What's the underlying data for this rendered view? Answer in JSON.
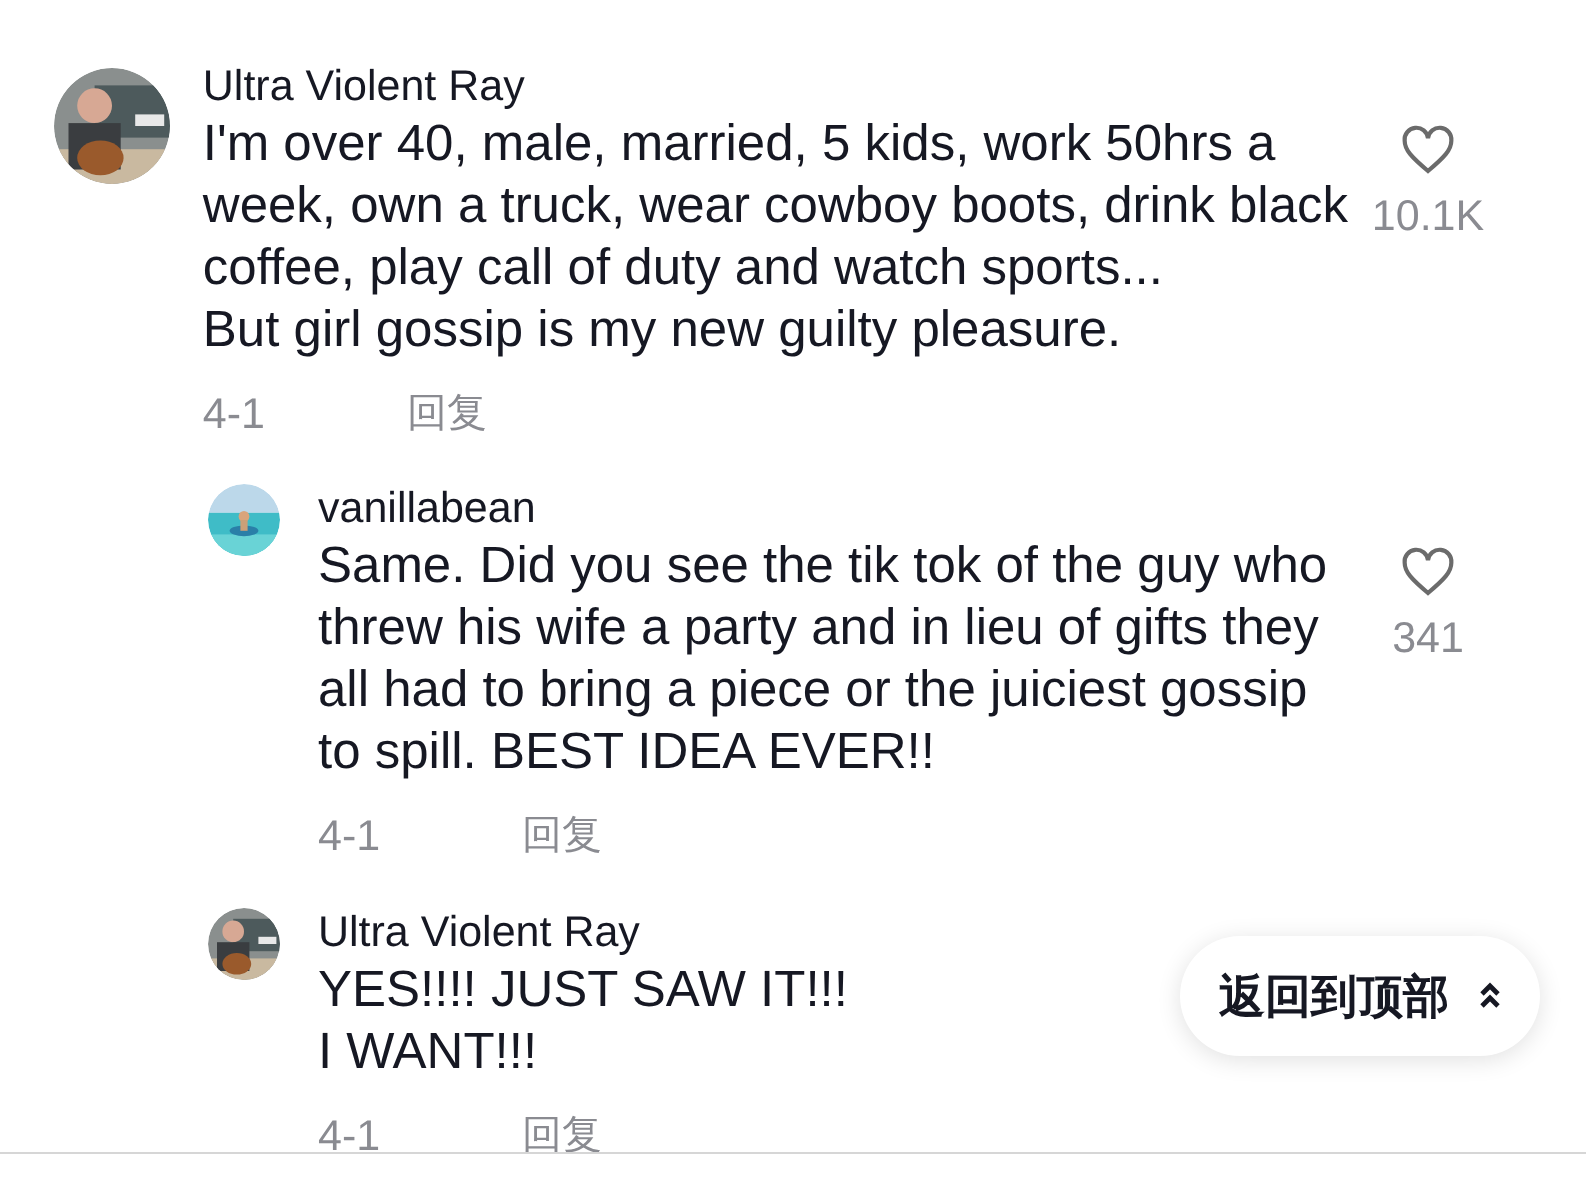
{
  "comments": [
    {
      "author": "Ultra Violent Ray",
      "lines": [
        "I'm over 40, male, married, 5 kids, work 50hrs a",
        "week, own a truck, wear cowboy boots, drink black",
        "coffee, play call of duty and watch sports...",
        "But girl gossip is my new guilty pleasure."
      ],
      "date": "4-1",
      "reply": "回复",
      "likes": "10.1K",
      "replies": [
        {
          "author": "vanillabean",
          "lines": [
            "Same. Did you see the tik tok of the guy who",
            "threw his wife a party and in lieu of gifts they",
            "all had to bring a piece or the juiciest gossip",
            "to spill. BEST IDEA EVER!!"
          ],
          "date": "4-1",
          "reply": "回复",
          "likes": "341"
        },
        {
          "author": "Ultra Violent Ray",
          "lines": [
            "YES!!!! JUST SAW IT!!!",
            "I WANT!!!"
          ],
          "date": "4-1",
          "reply": "回复"
        }
      ]
    }
  ],
  "back_to_top": {
    "label": "返回到顶部"
  }
}
